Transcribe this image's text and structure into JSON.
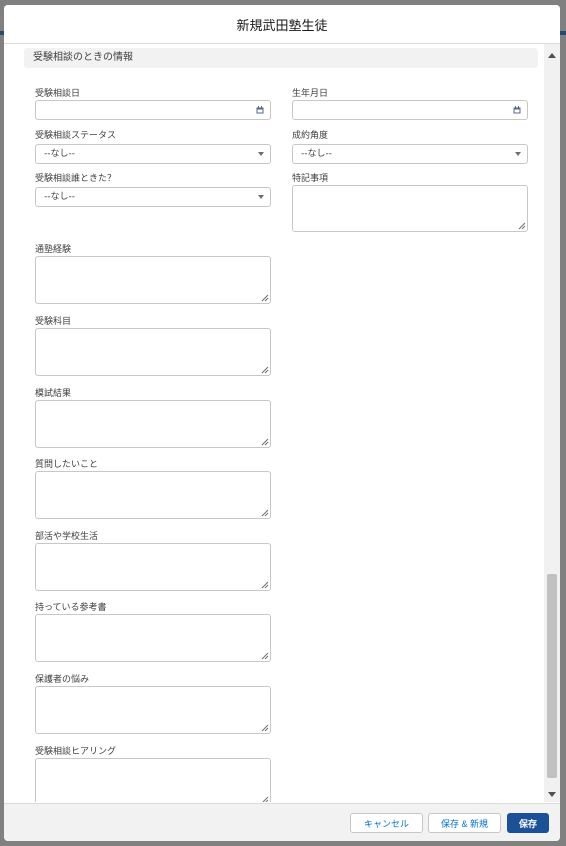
{
  "modal": {
    "title": "新規武田塾生徒"
  },
  "section": {
    "title": "受験相談のときの情報"
  },
  "fields": {
    "consult_date": {
      "label": "受験相談日",
      "value": ""
    },
    "birth_date": {
      "label": "生年月日",
      "value": ""
    },
    "consult_status": {
      "label": "受験相談ステータス",
      "value": "--なし--"
    },
    "close_angle": {
      "label": "成約角度",
      "value": "--なし--"
    },
    "who_came": {
      "label": "受験相談誰ときた？",
      "value": "--なし--"
    },
    "special_notes": {
      "label": "特記事項"
    },
    "cram_experience": {
      "label": "通塾経験"
    },
    "exam_subjects": {
      "label": "受験科目"
    },
    "mock_results": {
      "label": "模試結果"
    },
    "questions": {
      "label": "質問したいこと"
    },
    "club_school": {
      "label": "部活や学校生活"
    },
    "ref_books": {
      "label": "持っている参考書"
    },
    "parent_worries": {
      "label": "保護者の悩み"
    },
    "consult_hearing": {
      "label": "受験相談ヒアリング"
    }
  },
  "footer": {
    "cancel_label": "キャンセル",
    "save_new_label": "保存 & 新規",
    "save_label": "保存"
  },
  "icons": {
    "calendar": "calendar-icon",
    "dropdown": "chevron-down-icon",
    "resize": "resize-grip-icon"
  },
  "colors": {
    "brand": "#1b5297",
    "link": "#0070d2",
    "section_bg": "#f3f2f2"
  }
}
